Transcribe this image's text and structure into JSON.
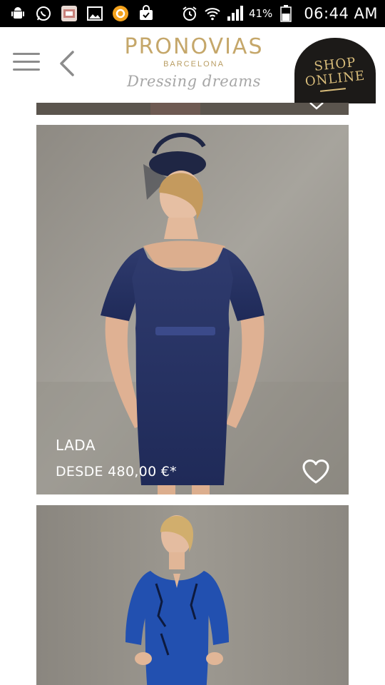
{
  "status_bar": {
    "battery_percent": "41%",
    "time": "06:44 AM",
    "left_icons": [
      "android-debug-icon",
      "whatsapp-icon",
      "app-icon",
      "gallery-icon",
      "orange-app-icon",
      "shopping-bag-icon"
    ],
    "right_icons": [
      "alarm-icon",
      "wifi-icon",
      "signal-icon",
      "battery-icon"
    ]
  },
  "header": {
    "brand": "PRONOVIAS",
    "city": "BARCELONA",
    "tagline": "Dressing dreams",
    "shop_badge_line1": "SHOP",
    "shop_badge_line2": "ONLINE",
    "brand_color": "#c5a76a"
  },
  "products": [
    {
      "name": "LADA",
      "price": "DESDE 480,00 €*",
      "favorite": false
    }
  ]
}
